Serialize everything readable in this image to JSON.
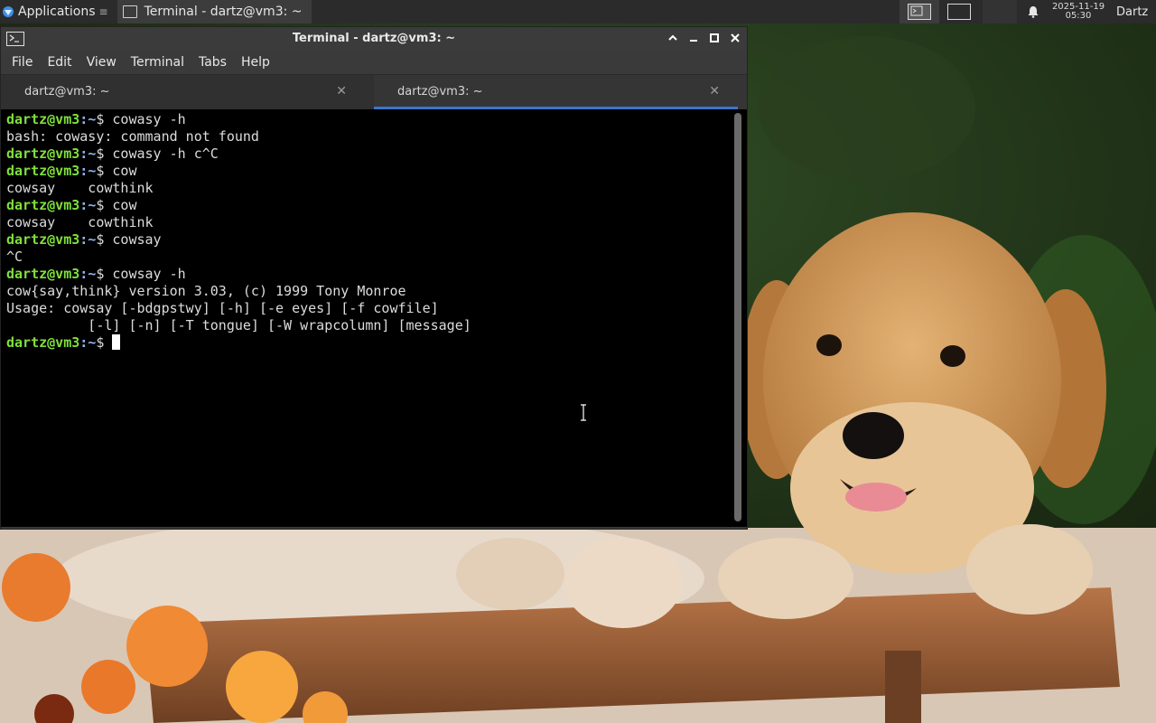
{
  "panel": {
    "apps_label": "Applications",
    "taskbar_title": "Terminal - dartz@vm3: ~",
    "clock_date": "2025-11-19",
    "clock_time": "05:30",
    "user": "Dartz"
  },
  "window": {
    "title": "Terminal - dartz@vm3: ~",
    "menu": [
      "File",
      "Edit",
      "View",
      "Terminal",
      "Tabs",
      "Help"
    ],
    "tabs": [
      {
        "label": "dartz@vm3: ~",
        "active": false
      },
      {
        "label": "dartz@vm3: ~",
        "active": true
      }
    ]
  },
  "terminal": {
    "prompt_user": "dartz@vm3",
    "prompt_path": ":~",
    "prompt_symbol": "$ ",
    "lines": [
      {
        "type": "cmd",
        "text": "cowasy -h"
      },
      {
        "type": "out",
        "text": "bash: cowasy: command not found"
      },
      {
        "type": "cmd",
        "text": "cowasy -h c^C"
      },
      {
        "type": "cmd",
        "text": "cow"
      },
      {
        "type": "out",
        "text": "cowsay    cowthink"
      },
      {
        "type": "cmd",
        "text": "cow"
      },
      {
        "type": "out",
        "text": "cowsay    cowthink"
      },
      {
        "type": "cmd",
        "text": "cowsay"
      },
      {
        "type": "out",
        "text": "^C"
      },
      {
        "type": "cmd",
        "text": "cowsay -h"
      },
      {
        "type": "out",
        "text": "cow{say,think} version 3.03, (c) 1999 Tony Monroe"
      },
      {
        "type": "out",
        "text": "Usage: cowsay [-bdgpstwy] [-h] [-e eyes] [-f cowfile]"
      },
      {
        "type": "out",
        "text": "          [-l] [-n] [-T tongue] [-W wrapcolumn] [message]"
      },
      {
        "type": "cursor",
        "text": ""
      }
    ]
  }
}
